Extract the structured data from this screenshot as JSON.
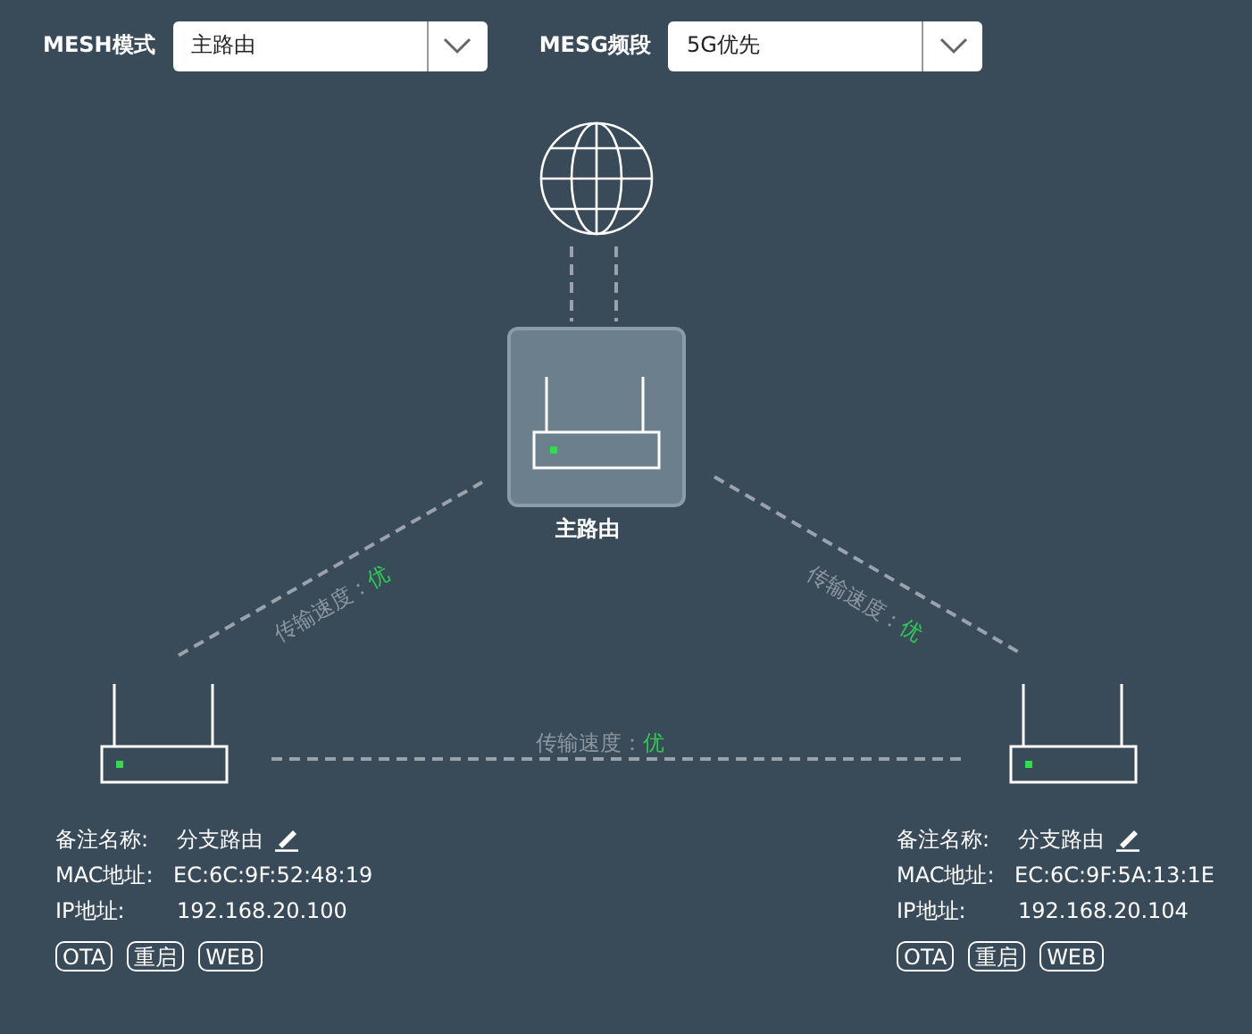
{
  "selects": [
    {
      "label": "MESH模式",
      "value": "主路由"
    },
    {
      "label": "MESG频段",
      "value": "5G优先"
    }
  ],
  "main_router": {
    "label": "主路由"
  },
  "links": [
    {
      "label": "传输速度：",
      "quality": "优"
    },
    {
      "label": "传输速度：",
      "quality": "优"
    },
    {
      "label": "传输速度：",
      "quality": "优"
    }
  ],
  "nodes": [
    {
      "name_label": "备注名称:",
      "name": "分支路由",
      "mac_label": "MAC地址:",
      "mac": "EC:6C:9F:52:48:19",
      "ip_label": "IP地址:",
      "ip": "192.168.20.100",
      "buttons": [
        "OTA",
        "重启",
        "WEB"
      ]
    },
    {
      "name_label": "备注名称:",
      "name": "分支路由",
      "mac_label": "MAC地址:",
      "mac": "EC:6C:9F:5A:13:1E",
      "ip_label": "IP地址:",
      "ip": "192.168.20.104",
      "buttons": [
        "OTA",
        "重启",
        "WEB"
      ]
    }
  ]
}
